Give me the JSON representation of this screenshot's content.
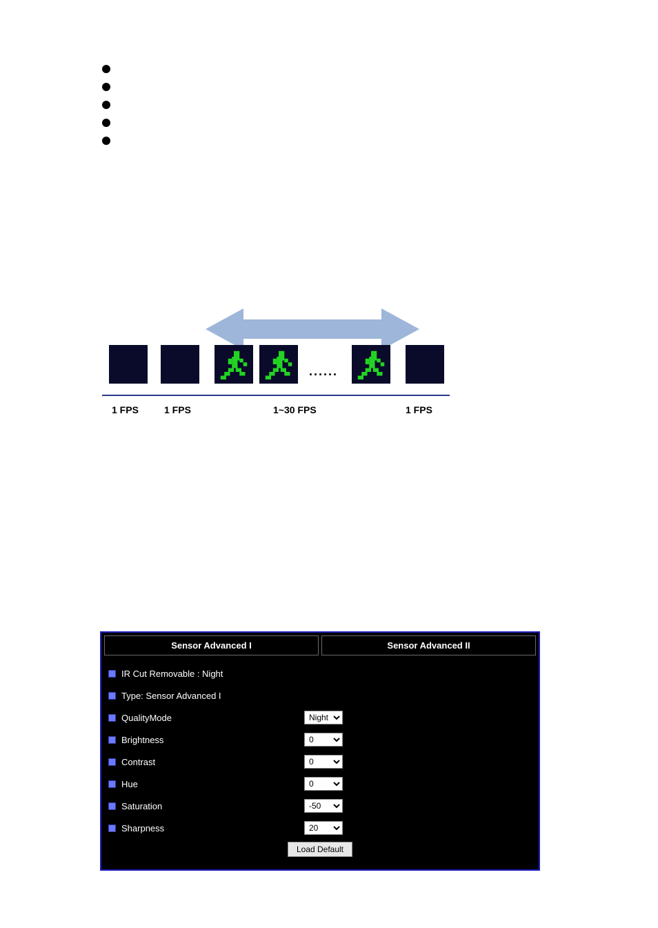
{
  "bullets": {
    "count": 5
  },
  "diagram": {
    "dots": "......",
    "fps": {
      "l1": "1 FPS",
      "l2": "1 FPS",
      "mid": "1~30 FPS",
      "r": "1 FPS"
    }
  },
  "sensor_panel": {
    "tabs": [
      {
        "label": "Sensor Advanced I"
      },
      {
        "label": "Sensor Advanced II"
      }
    ],
    "ir_cut": "IR Cut Removable : Night",
    "type": "Type: Sensor Advanced I",
    "quality_mode": {
      "label": "QualityMode",
      "value": "Night"
    },
    "brightness": {
      "label": "Brightness",
      "value": "0"
    },
    "contrast": {
      "label": "Contrast",
      "value": "0"
    },
    "hue": {
      "label": "Hue",
      "value": "0"
    },
    "saturation": {
      "label": "Saturation",
      "value": "-50"
    },
    "sharpness": {
      "label": "Sharpness",
      "value": "20"
    },
    "load_default": "Load Default"
  }
}
